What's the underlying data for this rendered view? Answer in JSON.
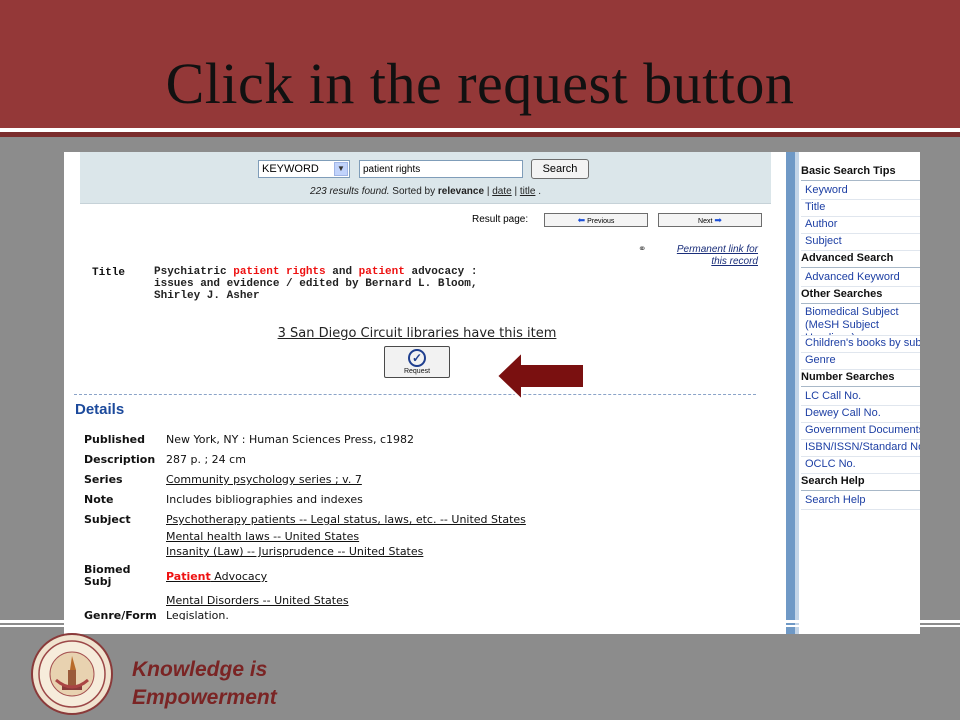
{
  "slide": {
    "title": "Click in the request button",
    "motto_line1": "Knowledge is",
    "motto_line2": "Empowerment",
    "seal_text": "UNITED STATES UNIVERSITY"
  },
  "search": {
    "type": "KEYWORD",
    "query": "patient rights",
    "button": "Search",
    "results_count": "223 results found.",
    "sorted_by_label": "Sorted by",
    "sort_relevance": "relevance",
    "sort_sep": "|",
    "sort_date": "date",
    "sort_title": "title",
    "sort_end": "."
  },
  "pager": {
    "label": "Result page:",
    "previous": "Previous",
    "next": "Next"
  },
  "record": {
    "permanent_link_line1": "Permanent link for",
    "permanent_link_line2": "this record",
    "title_label": "Title",
    "title_part1": "Psychiatric ",
    "title_hl1": "patient rights",
    "title_part2": " and ",
    "title_hl2": "patient",
    "title_part3": " advocacy : issues and evidence / edited by Bernard L. Bloom, Shirley J. Asher",
    "holdings": "3 San Diego Circuit libraries have this item",
    "request_button": "Request"
  },
  "details": {
    "heading": "Details",
    "published_label": "Published",
    "published_value": "New York, NY : Human Sciences Press, c1982",
    "description_label": "Description",
    "description_value": "287 p. ; 24 cm",
    "series_label": "Series",
    "series_value": "Community psychology series ; v. 7",
    "note_label": "Note",
    "note_value": "Includes bibliographies and indexes",
    "subject_label": "Subject",
    "subject_1": "Psychotherapy patients -- Legal status, laws, etc. -- United States",
    "subject_2": "Mental health laws -- United States",
    "subject_3": "Insanity (Law) -- Jurisprudence -- United States",
    "biomed_label_1": "Biomed",
    "biomed_label_2": "Subj",
    "biomed_1_hl": "Patient",
    "biomed_1_rest": " Advocacy",
    "biomed_2": "Mental Disorders -- United States",
    "genre_label": "Genre/Form",
    "genre_value": "Legislation."
  },
  "sidebar": {
    "basic_head": "Basic Search Tips",
    "basic_items": [
      "Keyword",
      "Title",
      "Author",
      "Subject"
    ],
    "advanced_head": "Advanced Search",
    "advanced_items": [
      "Advanced Keyword"
    ],
    "other_head": "Other Searches",
    "other_item_1": "Biomedical Subject (MeSH Subject Headings)",
    "other_item_2": "Children's books by subject",
    "other_item_3": "Genre",
    "number_head": "Number Searches",
    "number_items": [
      "LC Call No.",
      "Dewey Call No.",
      "Government Documents",
      "ISBN/ISSN/Standard No.",
      "OCLC No."
    ],
    "help_head": "Search Help",
    "help_items": [
      "Search Help"
    ]
  },
  "colors": {
    "header": "#943838",
    "annotation_arrow": "#7a1010",
    "link_blue": "#1d3fa4",
    "highlight_red": "#ee1111"
  }
}
